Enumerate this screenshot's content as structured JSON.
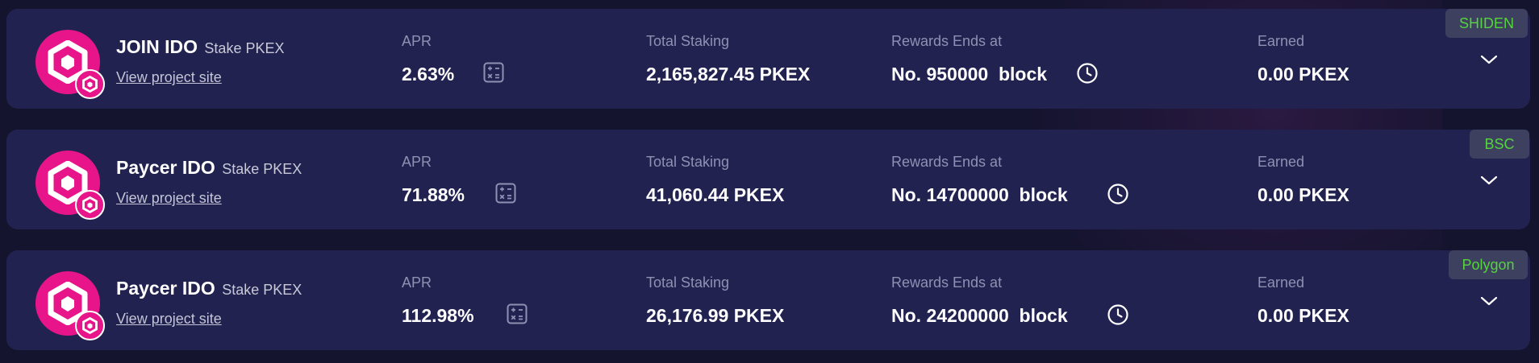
{
  "colors": {
    "background": "#14142e",
    "card": "#212250",
    "accent_pink": "#e8158a",
    "network_green": "#55d43d",
    "label_gray": "#8f91b3"
  },
  "icons": {
    "calculator": "calculator-icon",
    "clock": "clock-icon",
    "expand": "chevron-down-icon",
    "logo": "paycer-logo-icon"
  },
  "pools": [
    {
      "name": "JOIN IDO",
      "stake_label": "Stake PKEX",
      "link_text": "View project site",
      "apr_label": "APR",
      "apr_value": "2.63%",
      "total_label": "Total Staking",
      "total_value": "2,165,827.45 PKEX",
      "rewards_label": "Rewards Ends at",
      "rewards_value": "No. 950000  block",
      "earned_label": "Earned",
      "earned_value": "0.00 PKEX",
      "network": "SHIDEN"
    },
    {
      "name": "Paycer IDO",
      "stake_label": "Stake PKEX",
      "link_text": "View project site",
      "apr_label": "APR",
      "apr_value": "71.88%",
      "total_label": "Total Staking",
      "total_value": "41,060.44 PKEX",
      "rewards_label": "Rewards Ends at",
      "rewards_value": "No. 14700000  block",
      "earned_label": "Earned",
      "earned_value": "0.00 PKEX",
      "network": "BSC"
    },
    {
      "name": "Paycer IDO",
      "stake_label": "Stake PKEX",
      "link_text": "View project site",
      "apr_label": "APR",
      "apr_value": "112.98%",
      "total_label": "Total Staking",
      "total_value": "26,176.99 PKEX",
      "rewards_label": "Rewards Ends at",
      "rewards_value": "No. 24200000  block",
      "earned_label": "Earned",
      "earned_value": "0.00 PKEX",
      "network": "Polygon"
    }
  ]
}
